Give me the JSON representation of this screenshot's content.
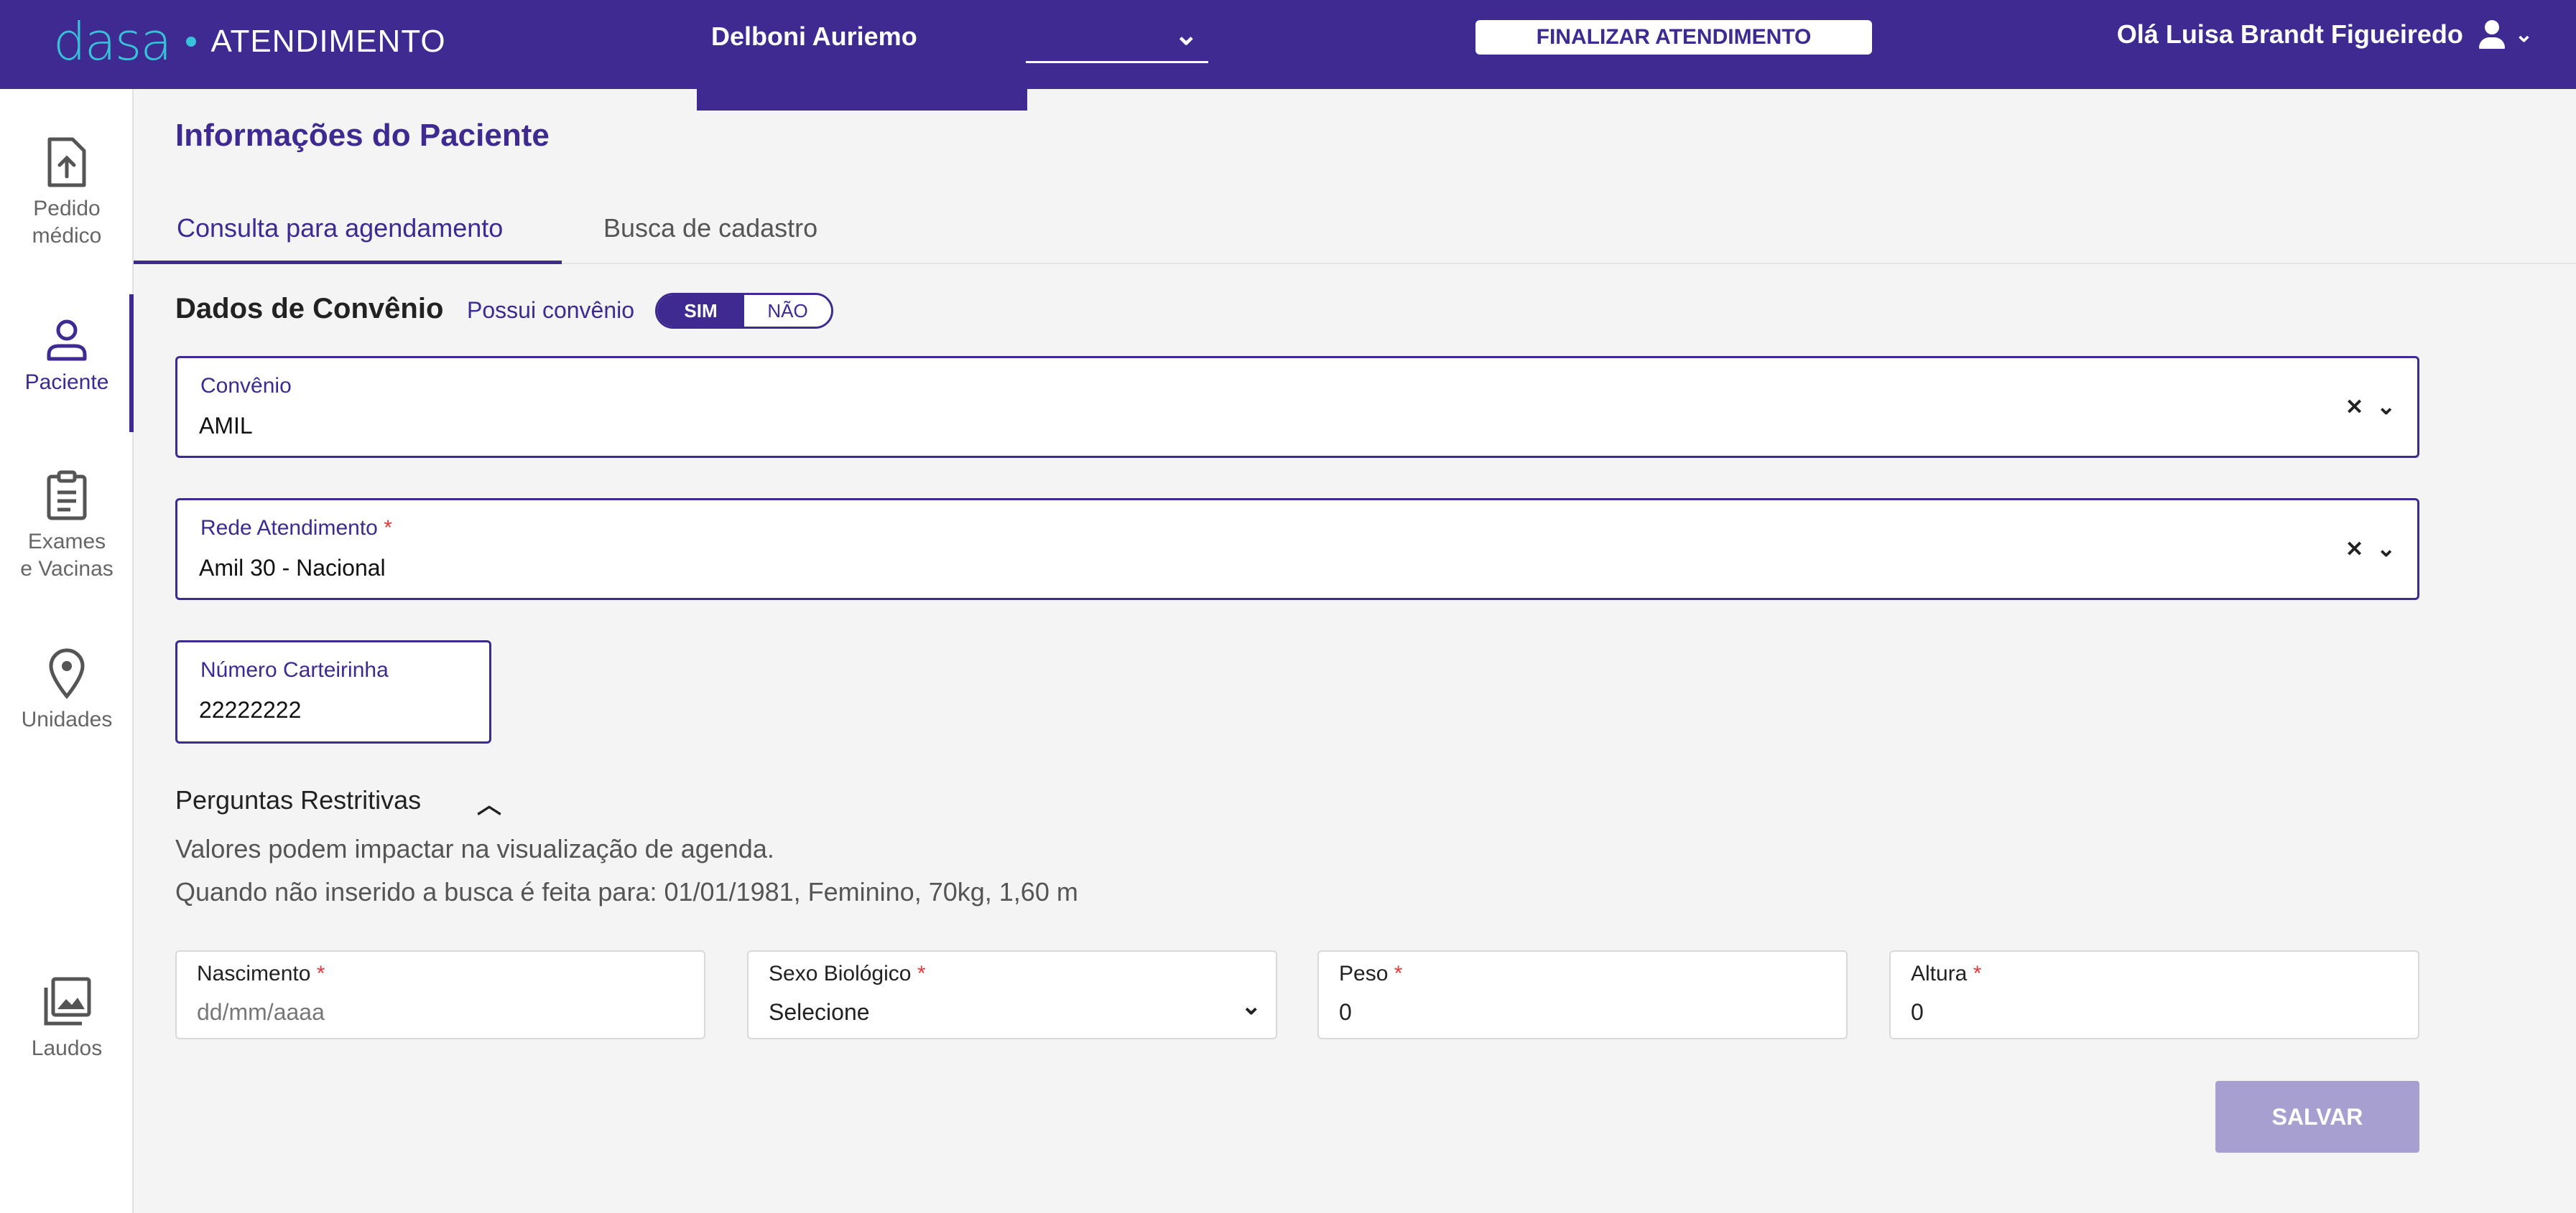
{
  "header": {
    "logo_brand": "dasa",
    "app_name": "ATENDIMENTO",
    "unit_name": "Delboni Auriemo",
    "finalize_button": "FINALIZAR ATENDIMENTO",
    "greeting": "Olá Luisa Brandt Figueiredo",
    "brand_color": "#3e2a91",
    "logo_color": "#38c2d9"
  },
  "sidebar": {
    "items": [
      {
        "line1": "Pedido",
        "line2": "médico",
        "icon": "upload-document-icon"
      },
      {
        "line1": "Paciente",
        "icon": "user-icon"
      },
      {
        "line1": "Exames",
        "line2": "e Vacinas",
        "icon": "clipboard-icon"
      },
      {
        "line1": "Unidades",
        "icon": "map-pin-icon"
      },
      {
        "line1": "Laudos",
        "icon": "images-icon"
      }
    ],
    "active": "Paciente"
  },
  "main": {
    "title": "Informações do Paciente",
    "tabs": [
      {
        "label": "Consulta para agendamento",
        "active": true
      },
      {
        "label": "Busca de cadastro",
        "active": false
      }
    ],
    "section_title": "Dados de Convênio",
    "has_insurance_label": "Possui convênio",
    "toggle_yes": "SIM",
    "toggle_no": "NÃO",
    "convenio": {
      "label": "Convênio",
      "value": "AMIL"
    },
    "rede": {
      "label": "Rede Atendimento",
      "required_mark": "*",
      "value": "Amil 30 - Nacional"
    },
    "carteirinha": {
      "label": "Número Carteirinha",
      "value": "22222222"
    },
    "questions_title": "Perguntas Restritivas",
    "note1": "Valores podem impactar na visualização de agenda.",
    "note2": "Quando não inserido a busca é feita para: 01/01/1981, Feminino, 70kg, 1,60 m",
    "nascimento": {
      "label": "Nascimento",
      "placeholder": "dd/mm/aaaa"
    },
    "sexo": {
      "label": "Sexo Biológico",
      "value": "Selecione"
    },
    "peso": {
      "label": "Peso",
      "value": "0"
    },
    "altura": {
      "label": "Altura",
      "value": "0"
    },
    "required_mark": "*",
    "save_button": "SALVAR"
  }
}
